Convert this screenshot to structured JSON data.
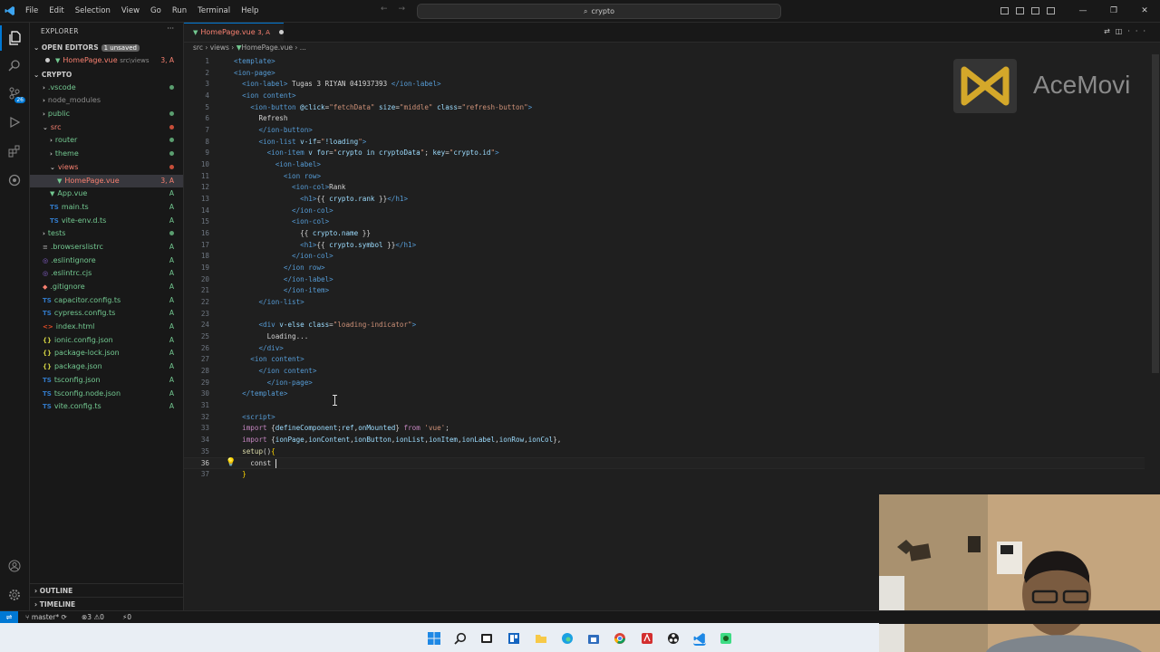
{
  "menu": [
    "File",
    "Edit",
    "Selection",
    "View",
    "Go",
    "Run",
    "Terminal",
    "Help"
  ],
  "search": {
    "text": "crypto"
  },
  "window_controls": [
    "—",
    "❐",
    "✕"
  ],
  "explorer": {
    "title": "EXPLORER",
    "open_editors_label": "OPEN EDITORS",
    "unsaved_badge": "1 unsaved",
    "open_file": {
      "name": "HomePage.vue",
      "path": "src\\views",
      "status": "3, A"
    },
    "project": "CRYPTO",
    "tree": [
      {
        "name": ".vscode",
        "indent": 1,
        "type": "folder",
        "status": "dot-green"
      },
      {
        "name": "node_modules",
        "indent": 1,
        "type": "folder",
        "status": ""
      },
      {
        "name": "public",
        "indent": 1,
        "type": "folder",
        "status": "dot-green"
      },
      {
        "name": "src",
        "indent": 1,
        "type": "folder-open",
        "status": "dot-red"
      },
      {
        "name": "router",
        "indent": 2,
        "type": "folder",
        "status": "dot-green"
      },
      {
        "name": "theme",
        "indent": 2,
        "type": "folder",
        "status": "dot-green"
      },
      {
        "name": "views",
        "indent": 2,
        "type": "folder-open",
        "status": "dot-red"
      },
      {
        "name": "HomePage.vue",
        "indent": 3,
        "type": "vue",
        "status": "3, A",
        "selected": true
      },
      {
        "name": "App.vue",
        "indent": 2,
        "type": "vue",
        "status": "A"
      },
      {
        "name": "main.ts",
        "indent": 2,
        "type": "ts",
        "status": "A"
      },
      {
        "name": "vite-env.d.ts",
        "indent": 2,
        "type": "ts",
        "status": "A"
      },
      {
        "name": "tests",
        "indent": 1,
        "type": "folder",
        "status": "dot-green"
      },
      {
        "name": ".browserslistrc",
        "indent": 1,
        "type": "file",
        "status": "A"
      },
      {
        "name": ".eslintignore",
        "indent": 1,
        "type": "eslint",
        "status": "A"
      },
      {
        "name": ".eslintrc.cjs",
        "indent": 1,
        "type": "eslint",
        "status": "A"
      },
      {
        "name": ".gitignore",
        "indent": 1,
        "type": "git",
        "status": "A"
      },
      {
        "name": "capacitor.config.ts",
        "indent": 1,
        "type": "ts",
        "status": "A"
      },
      {
        "name": "cypress.config.ts",
        "indent": 1,
        "type": "ts",
        "status": "A"
      },
      {
        "name": "index.html",
        "indent": 1,
        "type": "html",
        "status": "A"
      },
      {
        "name": "ionic.config.json",
        "indent": 1,
        "type": "json",
        "status": "A"
      },
      {
        "name": "package-lock.json",
        "indent": 1,
        "type": "json",
        "status": "A"
      },
      {
        "name": "package.json",
        "indent": 1,
        "type": "json",
        "status": "A"
      },
      {
        "name": "tsconfig.json",
        "indent": 1,
        "type": "tsc",
        "status": "A"
      },
      {
        "name": "tsconfig.node.json",
        "indent": 1,
        "type": "tsc",
        "status": "A"
      },
      {
        "name": "vite.config.ts",
        "indent": 1,
        "type": "ts",
        "status": "A"
      }
    ],
    "outline": "OUTLINE",
    "timeline": "TIMELINE"
  },
  "tab": {
    "name": "HomePage.vue",
    "status": "3, A"
  },
  "breadcrumb": [
    "src",
    "views",
    "HomePage.vue",
    "..."
  ],
  "code_lines": [
    [
      [
        "tg",
        "<template>"
      ]
    ],
    [
      [
        "tg",
        "<ion-page>"
      ]
    ],
    [
      [
        "sp",
        "  "
      ],
      [
        "tg",
        "<ion-label>"
      ],
      [
        "txt",
        " Tugas 3 RIYAN 041937393 "
      ],
      [
        "tg",
        "</ion-label>"
      ]
    ],
    [
      [
        "sp",
        "  "
      ],
      [
        "tg",
        "<ion content>"
      ]
    ],
    [
      [
        "sp",
        "    "
      ],
      [
        "tg",
        "<ion-button "
      ],
      [
        "at",
        "@click"
      ],
      [
        "txt",
        "="
      ],
      [
        "sv",
        "\"fetchData\""
      ],
      [
        "at",
        " size"
      ],
      [
        "txt",
        "="
      ],
      [
        "sv",
        "\"middle\""
      ],
      [
        "at",
        " class"
      ],
      [
        "txt",
        "="
      ],
      [
        "sv",
        "\"refresh-button\""
      ],
      [
        "tg",
        ">"
      ]
    ],
    [
      [
        "sp",
        "      "
      ],
      [
        "txt",
        "Refresh"
      ]
    ],
    [
      [
        "sp",
        "      "
      ],
      [
        "tg",
        "</ion-button>"
      ]
    ],
    [
      [
        "sp",
        "      "
      ],
      [
        "tg",
        "<ion-list "
      ],
      [
        "at",
        "v-if"
      ],
      [
        "txt",
        "="
      ],
      [
        "sv",
        "\""
      ],
      [
        "vr",
        "!loading"
      ],
      [
        "sv",
        "\""
      ],
      [
        "tg",
        ">"
      ]
    ],
    [
      [
        "sp",
        "        "
      ],
      [
        "tg",
        "<ion-item "
      ],
      [
        "at",
        "v for"
      ],
      [
        "txt",
        "="
      ],
      [
        "sv",
        "\""
      ],
      [
        "vr",
        "crypto in cryptoData"
      ],
      [
        "sv",
        "\""
      ],
      [
        "txt",
        "; "
      ],
      [
        "at",
        "key"
      ],
      [
        "txt",
        "="
      ],
      [
        "sv",
        "\""
      ],
      [
        "vr",
        "crypto.id"
      ],
      [
        "sv",
        "\""
      ],
      [
        "tg",
        ">"
      ]
    ],
    [
      [
        "sp",
        "          "
      ],
      [
        "tg",
        "<ion-label>"
      ]
    ],
    [
      [
        "sp",
        "            "
      ],
      [
        "tg",
        "<ion row>"
      ]
    ],
    [
      [
        "sp",
        "              "
      ],
      [
        "tg",
        "<ion-col>"
      ],
      [
        "txt",
        "Rank"
      ]
    ],
    [
      [
        "sp",
        "                "
      ],
      [
        "tg",
        "<h1>"
      ],
      [
        "txt",
        "{{ "
      ],
      [
        "vr",
        "crypto.rank"
      ],
      [
        "txt",
        " }}"
      ],
      [
        "tg",
        "</h1>"
      ]
    ],
    [
      [
        "sp",
        "              "
      ],
      [
        "tg",
        "</ion-col>"
      ]
    ],
    [
      [
        "sp",
        "              "
      ],
      [
        "tg",
        "<ion-col>"
      ]
    ],
    [
      [
        "sp",
        "                "
      ],
      [
        "txt",
        "{{ "
      ],
      [
        "vr",
        "crypto.name"
      ],
      [
        "txt",
        " }}"
      ]
    ],
    [
      [
        "sp",
        "                "
      ],
      [
        "tg",
        "<h1>"
      ],
      [
        "txt",
        "{{ "
      ],
      [
        "vr",
        "crypto.symbol"
      ],
      [
        "txt",
        " }}"
      ],
      [
        "tg",
        "</h1>"
      ]
    ],
    [
      [
        "sp",
        "              "
      ],
      [
        "tg",
        "</ion-col>"
      ]
    ],
    [
      [
        "sp",
        "            "
      ],
      [
        "tg",
        "</ion row>"
      ]
    ],
    [
      [
        "sp",
        "            "
      ],
      [
        "tg",
        "</ion-label>"
      ]
    ],
    [
      [
        "sp",
        "            "
      ],
      [
        "tg",
        "</ion-item>"
      ]
    ],
    [
      [
        "sp",
        "      "
      ],
      [
        "tg",
        "</ion-list>"
      ]
    ],
    [],
    [
      [
        "sp",
        "      "
      ],
      [
        "tg",
        "<div "
      ],
      [
        "at",
        "v-else"
      ],
      [
        "at",
        " class"
      ],
      [
        "txt",
        "="
      ],
      [
        "sv",
        "\"loading-indicator\""
      ],
      [
        "tg",
        ">"
      ]
    ],
    [
      [
        "sp",
        "        "
      ],
      [
        "txt",
        "Loading..."
      ]
    ],
    [
      [
        "sp",
        "      "
      ],
      [
        "tg",
        "</div>"
      ]
    ],
    [
      [
        "sp",
        "    "
      ],
      [
        "tg",
        "<ion content>"
      ]
    ],
    [
      [
        "sp",
        "      "
      ],
      [
        "tg",
        "</ion content>"
      ]
    ],
    [
      [
        "sp",
        "        "
      ],
      [
        "tg",
        "</ion-page>"
      ]
    ],
    [
      [
        "sp",
        "  "
      ],
      [
        "tg",
        "</template>"
      ]
    ],
    [],
    [
      [
        "sp",
        "  "
      ],
      [
        "tg",
        "<script>"
      ]
    ],
    [
      [
        "sp",
        "  "
      ],
      [
        "kw",
        "import"
      ],
      [
        "txt",
        " {"
      ],
      [
        "vr",
        "defineComponent"
      ],
      [
        "txt",
        ";"
      ],
      [
        "vr",
        "ref"
      ],
      [
        "txt",
        ","
      ],
      [
        "vr",
        "onMounted"
      ],
      [
        "txt",
        "} "
      ],
      [
        "kw",
        "from"
      ],
      [
        "txt",
        " "
      ],
      [
        "sv",
        "'vue'"
      ],
      [
        "txt",
        ";"
      ]
    ],
    [
      [
        "sp",
        "  "
      ],
      [
        "kw",
        "import"
      ],
      [
        "txt",
        " {"
      ],
      [
        "vr",
        "ionPage"
      ],
      [
        "txt",
        ","
      ],
      [
        "vr",
        "ionContent"
      ],
      [
        "txt",
        ","
      ],
      [
        "vr",
        "ionButton"
      ],
      [
        "txt",
        ","
      ],
      [
        "vr",
        "ionList"
      ],
      [
        "txt",
        ","
      ],
      [
        "vr",
        "ionItem"
      ],
      [
        "txt",
        ","
      ],
      [
        "vr",
        "ionLabel"
      ],
      [
        "txt",
        ","
      ],
      [
        "vr",
        "ionRow"
      ],
      [
        "txt",
        ","
      ],
      [
        "vr",
        "ionCol"
      ],
      [
        "txt",
        "},"
      ]
    ],
    [
      [
        "sp",
        "  "
      ],
      [
        "fn",
        "setup"
      ],
      [
        "txt",
        "()"
      ],
      [
        "br",
        "{"
      ]
    ],
    [
      [
        "sp",
        "    "
      ],
      [
        "txt",
        "const "
      ]
    ],
    [
      [
        "sp",
        "  "
      ],
      [
        "br",
        "}"
      ]
    ]
  ],
  "current_line": 36,
  "watermark": {
    "text": "AceMovi"
  },
  "statusbar": {
    "branch": "master*",
    "errors": "⊗3 ⚠0",
    "ports": "⚡0"
  }
}
